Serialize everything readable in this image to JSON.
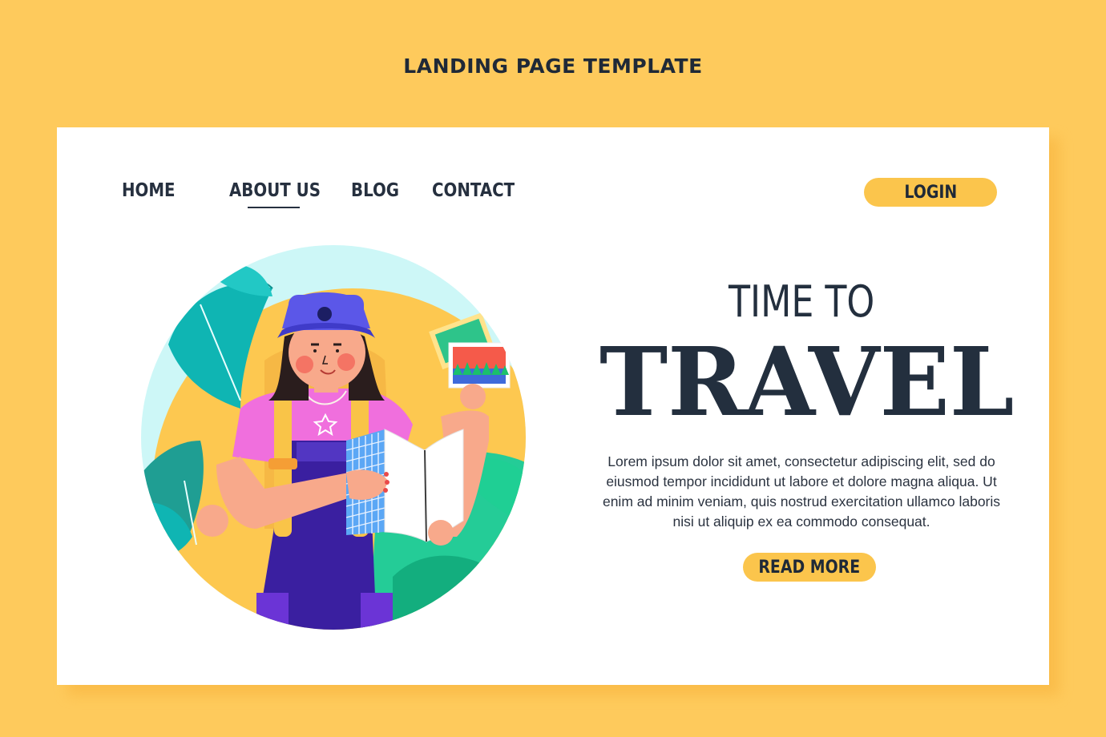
{
  "page": {
    "heading": "LANDING PAGE TEMPLATE"
  },
  "nav": {
    "items": [
      {
        "label": "HOME"
      },
      {
        "label": "ABOUT US",
        "active": true
      },
      {
        "label": "BLOG"
      },
      {
        "label": "CONTACT"
      }
    ],
    "login_label": "LOGIN"
  },
  "hero": {
    "subtitle": "TIME TO",
    "title": "TRAVEL",
    "description": "Lorem ipsum dolor sit amet, consectetur adipiscing elit, sed do eiusmod tempor incididunt ut labore et dolore magna aliqua. Ut enim ad minim veniam, quis nostrud exercitation ullamco laboris nisi ut aliquip ex ea commodo consequat.",
    "cta_label": "READ MORE"
  },
  "illustration": {
    "icon": "traveler-illustration"
  },
  "colors": {
    "background": "#FECA5C",
    "card": "#FFFFFF",
    "accent": "#FBC54C",
    "text": "#232F3E"
  }
}
